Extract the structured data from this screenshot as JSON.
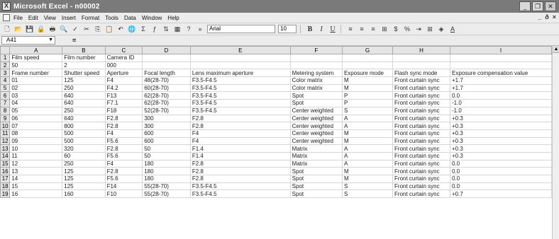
{
  "window": {
    "title": "Microsoft Excel - n00002"
  },
  "menu": [
    "File",
    "Edit",
    "View",
    "Insert",
    "Format",
    "Tools",
    "Data",
    "Window",
    "Help"
  ],
  "toolbar": {
    "font_name": "Arial",
    "font_size": "10",
    "bold": "B",
    "italic": "I",
    "underline": "U"
  },
  "formula_bar": {
    "cell_ref": "A41",
    "equals": "="
  },
  "columns": [
    "A",
    "B",
    "C",
    "D",
    "E",
    "F",
    "G",
    "H",
    "I"
  ],
  "rows": [
    [
      "Film speed",
      "Film number",
      "Camera ID",
      "",
      "",
      "",
      "",
      "",
      ""
    ],
    [
      "50",
      "2",
      "000",
      "",
      "",
      "",
      "",
      "",
      ""
    ],
    [
      "Frame number",
      "Shutter speed",
      "Aperture",
      "Focal length",
      "Lens maximum aperture",
      "Metering system",
      "Exposure mode",
      "Flash sync mode",
      "Exposure compensation value"
    ],
    [
      "01",
      "125",
      "F4",
      "48(28-70)",
      "F3.5-F4.5",
      "Color matrix",
      "M",
      "Front curtain sync",
      "+1.7"
    ],
    [
      "02",
      "250",
      "F4.2",
      "60(28-70)",
      "F3.5-F4.5",
      "Color matrix",
      "M",
      "Front curtain sync",
      "+1.7"
    ],
    [
      "03",
      "640",
      "F13",
      "62(28-70)",
      "F3.5-F4.5",
      "Spot",
      "P",
      "Front curtain sync",
      "0.0"
    ],
    [
      "04",
      "640",
      "F7.1",
      "62(28-70)",
      "F3.5-F4.5",
      "Spot",
      "P",
      "Front curtain sync",
      "-1.0"
    ],
    [
      "05",
      "250",
      "F18",
      "52(28-70)",
      "F3.5-F4.5",
      "Center weighted",
      "S",
      "Front curtain sync",
      "-1.0"
    ],
    [
      "06",
      "640",
      "F2.8",
      "300",
      "F2.8",
      "Center weighted",
      "A",
      "Front curtain sync",
      "+0.3"
    ],
    [
      "07",
      "800",
      "F2.8",
      "300",
      "F2.8",
      "Center weighted",
      "A",
      "Front curtain sync",
      "+0.3"
    ],
    [
      "08",
      "500",
      "F4",
      "600",
      "F4",
      "Center weighted",
      "M",
      "Front curtain sync",
      "+0.3"
    ],
    [
      "09",
      "500",
      "F5.6",
      "600",
      "F4",
      "Center weighted",
      "M",
      "Front curtain sync",
      "+0.3"
    ],
    [
      "10",
      "320",
      "F2.8",
      "50",
      "F1.4",
      "Matrix",
      "A",
      "Front curtain sync",
      "+0.3"
    ],
    [
      "11",
      "60",
      "F5.6",
      "50",
      "F1.4",
      "Matrix",
      "A",
      "Front curtain sync",
      "+0.3"
    ],
    [
      "12",
      "250",
      "F4",
      "180",
      "F2.8",
      "Matrix",
      "A",
      "Front curtain sync",
      "0.0"
    ],
    [
      "13",
      "125",
      "F2.8",
      "180",
      "F2.8",
      "Spot",
      "M",
      "Front curtain sync",
      "0.0"
    ],
    [
      "14",
      "125",
      "F5.6",
      "180",
      "F2.8",
      "Spot",
      "M",
      "Front curtain sync",
      "0.0"
    ],
    [
      "15",
      "125",
      "F14",
      "55(28-70)",
      "F3.5-F4.5",
      "Spot",
      "S",
      "Front curtain sync",
      "0.0"
    ],
    [
      "16",
      "160",
      "F10",
      "55(28-70)",
      "F3.5-F4.5",
      "Spot",
      "S",
      "Front curtain sync",
      "+0.7"
    ]
  ]
}
